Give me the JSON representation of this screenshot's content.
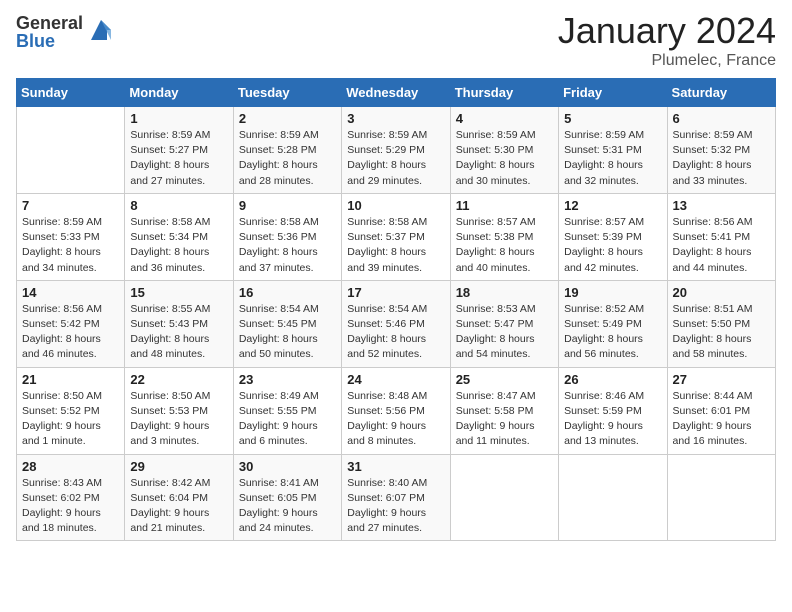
{
  "logo": {
    "general": "General",
    "blue": "Blue"
  },
  "header": {
    "month": "January 2024",
    "location": "Plumelec, France"
  },
  "days_of_week": [
    "Sunday",
    "Monday",
    "Tuesday",
    "Wednesday",
    "Thursday",
    "Friday",
    "Saturday"
  ],
  "weeks": [
    [
      {
        "day": "",
        "sunrise": "",
        "sunset": "",
        "daylight": ""
      },
      {
        "day": "1",
        "sunrise": "Sunrise: 8:59 AM",
        "sunset": "Sunset: 5:27 PM",
        "daylight": "Daylight: 8 hours and 27 minutes."
      },
      {
        "day": "2",
        "sunrise": "Sunrise: 8:59 AM",
        "sunset": "Sunset: 5:28 PM",
        "daylight": "Daylight: 8 hours and 28 minutes."
      },
      {
        "day": "3",
        "sunrise": "Sunrise: 8:59 AM",
        "sunset": "Sunset: 5:29 PM",
        "daylight": "Daylight: 8 hours and 29 minutes."
      },
      {
        "day": "4",
        "sunrise": "Sunrise: 8:59 AM",
        "sunset": "Sunset: 5:30 PM",
        "daylight": "Daylight: 8 hours and 30 minutes."
      },
      {
        "day": "5",
        "sunrise": "Sunrise: 8:59 AM",
        "sunset": "Sunset: 5:31 PM",
        "daylight": "Daylight: 8 hours and 32 minutes."
      },
      {
        "day": "6",
        "sunrise": "Sunrise: 8:59 AM",
        "sunset": "Sunset: 5:32 PM",
        "daylight": "Daylight: 8 hours and 33 minutes."
      }
    ],
    [
      {
        "day": "7",
        "sunrise": "Sunrise: 8:59 AM",
        "sunset": "Sunset: 5:33 PM",
        "daylight": "Daylight: 8 hours and 34 minutes."
      },
      {
        "day": "8",
        "sunrise": "Sunrise: 8:58 AM",
        "sunset": "Sunset: 5:34 PM",
        "daylight": "Daylight: 8 hours and 36 minutes."
      },
      {
        "day": "9",
        "sunrise": "Sunrise: 8:58 AM",
        "sunset": "Sunset: 5:36 PM",
        "daylight": "Daylight: 8 hours and 37 minutes."
      },
      {
        "day": "10",
        "sunrise": "Sunrise: 8:58 AM",
        "sunset": "Sunset: 5:37 PM",
        "daylight": "Daylight: 8 hours and 39 minutes."
      },
      {
        "day": "11",
        "sunrise": "Sunrise: 8:57 AM",
        "sunset": "Sunset: 5:38 PM",
        "daylight": "Daylight: 8 hours and 40 minutes."
      },
      {
        "day": "12",
        "sunrise": "Sunrise: 8:57 AM",
        "sunset": "Sunset: 5:39 PM",
        "daylight": "Daylight: 8 hours and 42 minutes."
      },
      {
        "day": "13",
        "sunrise": "Sunrise: 8:56 AM",
        "sunset": "Sunset: 5:41 PM",
        "daylight": "Daylight: 8 hours and 44 minutes."
      }
    ],
    [
      {
        "day": "14",
        "sunrise": "Sunrise: 8:56 AM",
        "sunset": "Sunset: 5:42 PM",
        "daylight": "Daylight: 8 hours and 46 minutes."
      },
      {
        "day": "15",
        "sunrise": "Sunrise: 8:55 AM",
        "sunset": "Sunset: 5:43 PM",
        "daylight": "Daylight: 8 hours and 48 minutes."
      },
      {
        "day": "16",
        "sunrise": "Sunrise: 8:54 AM",
        "sunset": "Sunset: 5:45 PM",
        "daylight": "Daylight: 8 hours and 50 minutes."
      },
      {
        "day": "17",
        "sunrise": "Sunrise: 8:54 AM",
        "sunset": "Sunset: 5:46 PM",
        "daylight": "Daylight: 8 hours and 52 minutes."
      },
      {
        "day": "18",
        "sunrise": "Sunrise: 8:53 AM",
        "sunset": "Sunset: 5:47 PM",
        "daylight": "Daylight: 8 hours and 54 minutes."
      },
      {
        "day": "19",
        "sunrise": "Sunrise: 8:52 AM",
        "sunset": "Sunset: 5:49 PM",
        "daylight": "Daylight: 8 hours and 56 minutes."
      },
      {
        "day": "20",
        "sunrise": "Sunrise: 8:51 AM",
        "sunset": "Sunset: 5:50 PM",
        "daylight": "Daylight: 8 hours and 58 minutes."
      }
    ],
    [
      {
        "day": "21",
        "sunrise": "Sunrise: 8:50 AM",
        "sunset": "Sunset: 5:52 PM",
        "daylight": "Daylight: 9 hours and 1 minute."
      },
      {
        "day": "22",
        "sunrise": "Sunrise: 8:50 AM",
        "sunset": "Sunset: 5:53 PM",
        "daylight": "Daylight: 9 hours and 3 minutes."
      },
      {
        "day": "23",
        "sunrise": "Sunrise: 8:49 AM",
        "sunset": "Sunset: 5:55 PM",
        "daylight": "Daylight: 9 hours and 6 minutes."
      },
      {
        "day": "24",
        "sunrise": "Sunrise: 8:48 AM",
        "sunset": "Sunset: 5:56 PM",
        "daylight": "Daylight: 9 hours and 8 minutes."
      },
      {
        "day": "25",
        "sunrise": "Sunrise: 8:47 AM",
        "sunset": "Sunset: 5:58 PM",
        "daylight": "Daylight: 9 hours and 11 minutes."
      },
      {
        "day": "26",
        "sunrise": "Sunrise: 8:46 AM",
        "sunset": "Sunset: 5:59 PM",
        "daylight": "Daylight: 9 hours and 13 minutes."
      },
      {
        "day": "27",
        "sunrise": "Sunrise: 8:44 AM",
        "sunset": "Sunset: 6:01 PM",
        "daylight": "Daylight: 9 hours and 16 minutes."
      }
    ],
    [
      {
        "day": "28",
        "sunrise": "Sunrise: 8:43 AM",
        "sunset": "Sunset: 6:02 PM",
        "daylight": "Daylight: 9 hours and 18 minutes."
      },
      {
        "day": "29",
        "sunrise": "Sunrise: 8:42 AM",
        "sunset": "Sunset: 6:04 PM",
        "daylight": "Daylight: 9 hours and 21 minutes."
      },
      {
        "day": "30",
        "sunrise": "Sunrise: 8:41 AM",
        "sunset": "Sunset: 6:05 PM",
        "daylight": "Daylight: 9 hours and 24 minutes."
      },
      {
        "day": "31",
        "sunrise": "Sunrise: 8:40 AM",
        "sunset": "Sunset: 6:07 PM",
        "daylight": "Daylight: 9 hours and 27 minutes."
      },
      {
        "day": "",
        "sunrise": "",
        "sunset": "",
        "daylight": ""
      },
      {
        "day": "",
        "sunrise": "",
        "sunset": "",
        "daylight": ""
      },
      {
        "day": "",
        "sunrise": "",
        "sunset": "",
        "daylight": ""
      }
    ]
  ]
}
